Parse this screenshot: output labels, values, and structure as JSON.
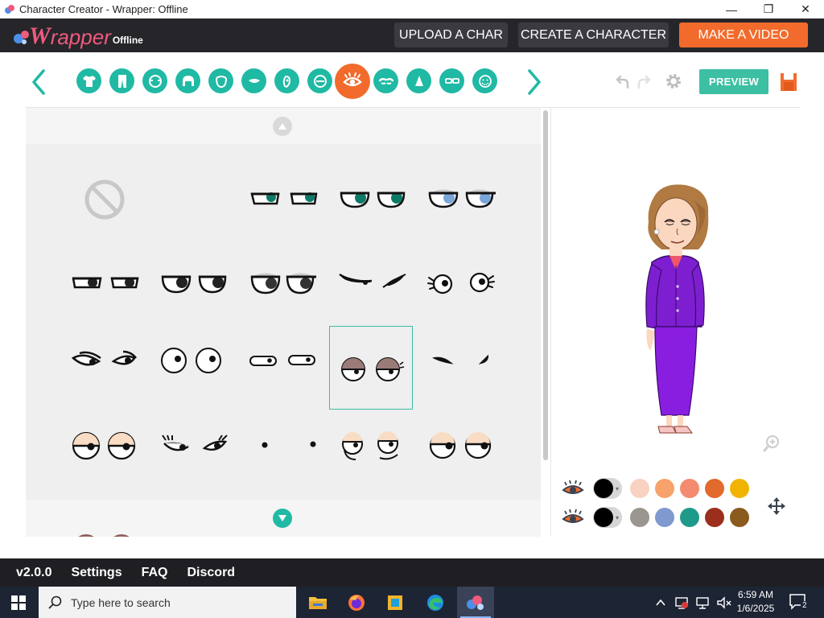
{
  "window": {
    "title": "Character Creator - Wrapper: Offline",
    "controls": {
      "minimize": "—",
      "maximize": "❐",
      "close": "✕"
    }
  },
  "header": {
    "logo_w": "W",
    "logo_rapper": "rapper",
    "logo_suffix": "Offline",
    "upload_label": "UPLOAD A CHAR",
    "create_label": "CREATE A CHARACTER",
    "video_label": "MAKE A VIDEO"
  },
  "toolbar": {
    "categories": [
      "shirt-icon",
      "pants-icon",
      "head-icon",
      "hair-icon",
      "face-shape-icon",
      "mouth-icon",
      "skin-icon",
      "ear-icon",
      "eye-icon",
      "eyebrow-icon",
      "nose-icon",
      "glasses-icon",
      "beard-icon"
    ],
    "active_category": "eye-icon",
    "preview_label": "PREVIEW",
    "accent": "#20b9a4",
    "active_color": "#f26b2c"
  },
  "grid": {
    "selected_index": 13,
    "item_count": 22
  },
  "colors": {
    "row1": {
      "main": "#000000",
      "swatches": [
        "#f9d2c2",
        "#f7a26a",
        "#f48a6f",
        "#e26a2c",
        "#f0b400"
      ]
    },
    "row2": {
      "main": "#000000",
      "swatches": [
        "#9b9590",
        "#7e9ad1",
        "#1f9a8a",
        "#9b2e1c",
        "#8a5a1e"
      ]
    }
  },
  "footer": {
    "version": "v2.0.0",
    "settings": "Settings",
    "faq": "FAQ",
    "discord": "Discord"
  },
  "taskbar": {
    "search_placeholder": "Type here to search",
    "time": "6:59 AM",
    "date": "1/6/2025",
    "notification_count": "2"
  }
}
